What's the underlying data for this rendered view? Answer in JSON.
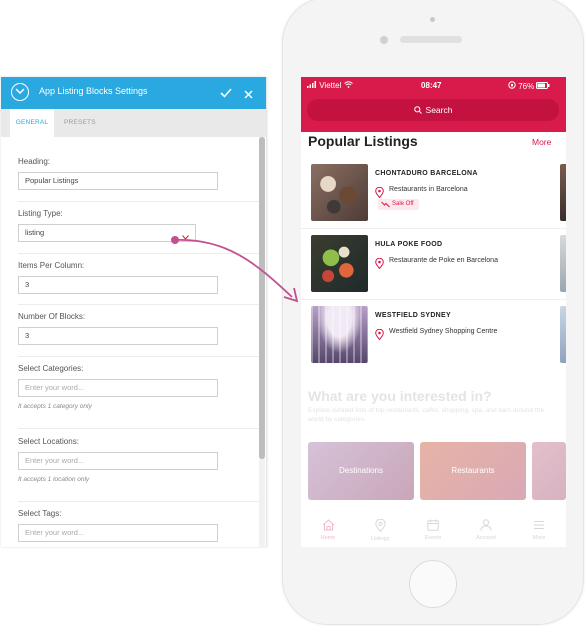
{
  "panel": {
    "title": "App Listing Blocks Settings",
    "tabs": [
      "GENERAL",
      "PRESETS"
    ],
    "fields": {
      "heading": {
        "label": "Heading:",
        "value": "Popular Listings"
      },
      "listing_type": {
        "label": "Listing Type:",
        "value": "listing"
      },
      "items_per_column": {
        "label": "Items Per Column:",
        "value": "3"
      },
      "number_of_blocks": {
        "label": "Number Of Blocks:",
        "value": "3"
      },
      "categories": {
        "label": "Select Categories:",
        "placeholder": "Enter your word...",
        "hint": "It accepts 1 category only"
      },
      "locations": {
        "label": "Select Locations:",
        "placeholder": "Enter your word...",
        "hint": "It accepts 1 location only"
      },
      "tags": {
        "label": "Select Tags:",
        "placeholder": "Enter your word..."
      }
    }
  },
  "phone": {
    "status": {
      "carrier": "Viettel",
      "time": "08:47",
      "battery": "76%"
    },
    "search_label": "Search",
    "section_title": "Popular Listings",
    "more_label": "More",
    "listings": [
      {
        "title": "CHONTADURO BARCELONA",
        "location": "Restaurants in Barcelona",
        "badge": "Sale Off"
      },
      {
        "title": "HULA POKE FOOD",
        "location": "Restaurante de Poke en Barcelona"
      },
      {
        "title": "WESTFIELD SYDNEY",
        "location": "Westfield Sydney Shopping Centre"
      }
    ],
    "interest_title": "What are you interested in?",
    "interest_sub": "Explore curated lists of top restaurants, cafes, shopping, spa, and bars around the world by categories.",
    "tiles": [
      "Destinations",
      "Restaurants"
    ],
    "tabbar": [
      "Home",
      "Listings",
      "Events",
      "Account",
      "More"
    ]
  },
  "colors": {
    "accent_blue": "#29a9df",
    "brand_red": "#d81b4a",
    "arrow": "#c2508f"
  }
}
